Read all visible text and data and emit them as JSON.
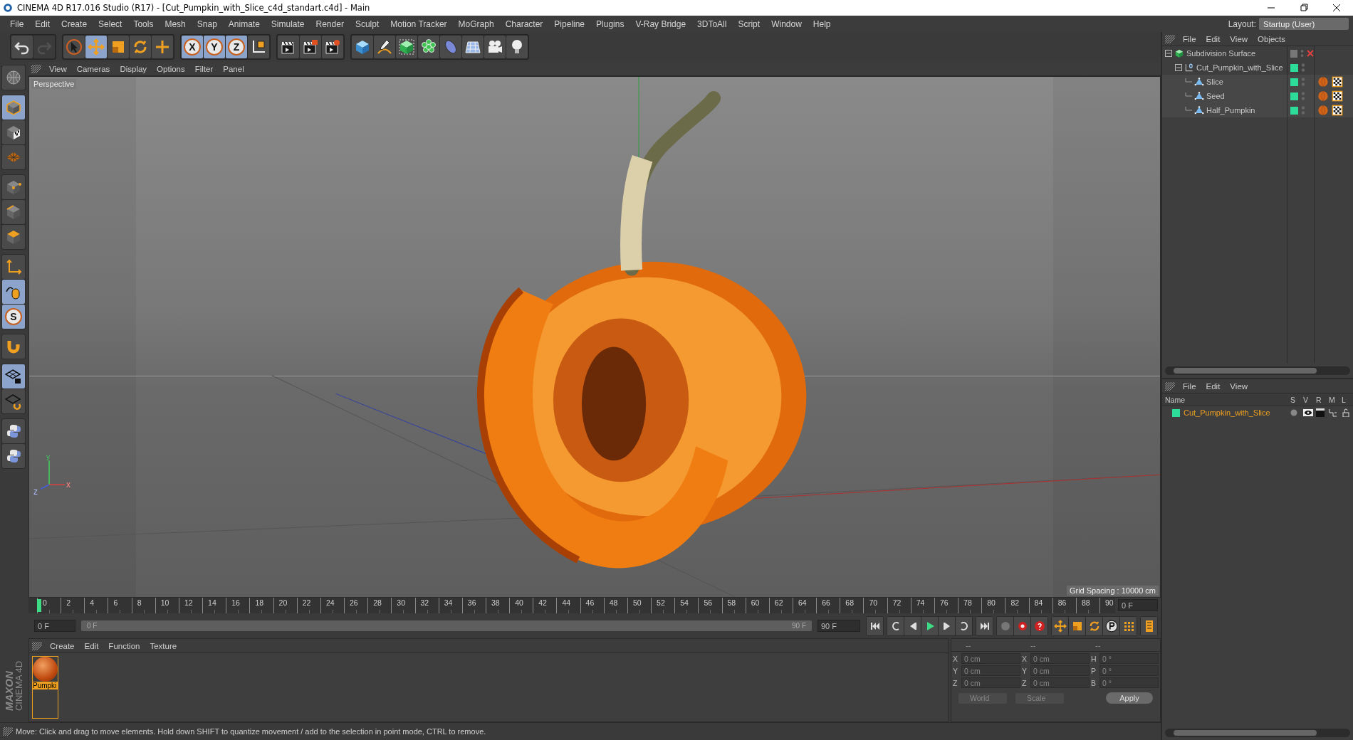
{
  "window": {
    "title": "CINEMA 4D R17.016 Studio (R17) - [Cut_Pumpkin_with_Slice_c4d_standart.c4d] - Main"
  },
  "menu": [
    "File",
    "Edit",
    "Create",
    "Select",
    "Tools",
    "Mesh",
    "Snap",
    "Animate",
    "Simulate",
    "Render",
    "Sculpt",
    "Motion Tracker",
    "MoGraph",
    "Character",
    "Pipeline",
    "Plugins",
    "V-Ray Bridge",
    "3DToAll",
    "Script",
    "Window",
    "Help"
  ],
  "layout": {
    "label": "Layout:",
    "value": "Startup (User)"
  },
  "toolbar": [
    [
      {
        "kind": "undo",
        "selected": false,
        "disabled": false
      },
      {
        "kind": "redo",
        "selected": false,
        "disabled": true
      }
    ],
    [
      {
        "kind": "cursor",
        "selected": false,
        "disabled": false
      },
      {
        "kind": "move",
        "selected": true,
        "disabled": false
      },
      {
        "kind": "scale",
        "selected": false,
        "disabled": false
      },
      {
        "kind": "rotate",
        "selected": false,
        "disabled": false
      },
      {
        "kind": "crosshair",
        "selected": false,
        "disabled": false
      }
    ],
    [
      {
        "kind": "letter",
        "label": "X",
        "selected": true,
        "disabled": false
      },
      {
        "kind": "letter",
        "label": "Y",
        "selected": true,
        "disabled": false
      },
      {
        "kind": "letter",
        "label": "Z",
        "selected": true,
        "disabled": false
      },
      {
        "kind": "axes",
        "selected": false,
        "disabled": false
      }
    ],
    [
      {
        "kind": "render-view",
        "selected": false,
        "disabled": false
      },
      {
        "kind": "render-picture",
        "selected": false,
        "disabled": false
      },
      {
        "kind": "render-settings",
        "selected": false,
        "disabled": false
      }
    ],
    [
      {
        "kind": "cube",
        "selected": false,
        "disabled": false
      },
      {
        "kind": "pen",
        "selected": false,
        "disabled": false
      },
      {
        "kind": "green-cube",
        "selected": false,
        "disabled": false
      },
      {
        "kind": "cluster",
        "selected": false,
        "disabled": false
      },
      {
        "kind": "bend",
        "selected": false,
        "disabled": false
      },
      {
        "kind": "floor",
        "selected": false,
        "disabled": false
      },
      {
        "kind": "camera",
        "selected": false,
        "disabled": false
      },
      {
        "kind": "bulb",
        "selected": false,
        "disabled": false
      }
    ]
  ],
  "left_tools": [
    [
      {
        "kind": "globe",
        "selected": false
      }
    ],
    [
      {
        "kind": "model",
        "selected": true
      },
      {
        "kind": "texture",
        "selected": false
      },
      {
        "kind": "workplane",
        "selected": false
      }
    ],
    [
      {
        "kind": "points",
        "selected": false
      },
      {
        "kind": "edges",
        "selected": false
      },
      {
        "kind": "polygons",
        "selected": false
      }
    ],
    [
      {
        "kind": "axis-l",
        "selected": false
      },
      {
        "kind": "tweak",
        "selected": true
      },
      {
        "kind": "letter",
        "label": "S",
        "selected": true
      }
    ],
    [
      {
        "kind": "magnet",
        "selected": false
      }
    ],
    [
      {
        "kind": "grid-lock",
        "selected": true
      },
      {
        "kind": "grid-rotate",
        "selected": false
      }
    ],
    [
      {
        "kind": "python",
        "selected": false
      },
      {
        "kind": "python",
        "selected": false
      }
    ]
  ],
  "viewport": {
    "menu": [
      "View",
      "Cameras",
      "Display",
      "Options",
      "Filter",
      "Panel"
    ],
    "camera_label": "Perspective",
    "grid_spacing": "Grid Spacing : 10000 cm",
    "gizmo": [
      "y",
      "z",
      "x"
    ]
  },
  "timeline": {
    "ticks": [
      "0",
      "2",
      "4",
      "6",
      "8",
      "10",
      "12",
      "14",
      "16",
      "18",
      "20",
      "22",
      "24",
      "26",
      "28",
      "30",
      "32",
      "34",
      "36",
      "38",
      "40",
      "42",
      "44",
      "46",
      "48",
      "50",
      "52",
      "54",
      "56",
      "58",
      "60",
      "62",
      "64",
      "66",
      "68",
      "70",
      "72",
      "74",
      "76",
      "78",
      "80",
      "82",
      "84",
      "86",
      "88",
      "90"
    ],
    "playhead": {
      "level": 0
    },
    "end_field": "0 F",
    "current_field": "0 F",
    "range": {
      "start": "0 F",
      "end": "90 F",
      "level": 1
    },
    "max_field": "90 F"
  },
  "materials": {
    "menu": [
      "Create",
      "Edit",
      "Function",
      "Texture"
    ],
    "items": [
      {
        "name": "Pumpki",
        "selected": true
      }
    ]
  },
  "coordinates": {
    "headers": [
      "--",
      "--",
      "--"
    ],
    "rows": [
      [
        {
          "label": "X",
          "value": "0 cm"
        },
        {
          "label": "X",
          "value": "0 cm"
        },
        {
          "label": "H",
          "value": "0 °"
        }
      ],
      [
        {
          "label": "Y",
          "value": "0 cm"
        },
        {
          "label": "Y",
          "value": "0 cm"
        },
        {
          "label": "P",
          "value": "0 °"
        }
      ],
      [
        {
          "label": "Z",
          "value": "0 cm"
        },
        {
          "label": "Z",
          "value": "0 cm"
        },
        {
          "label": "B",
          "value": "0 °"
        }
      ]
    ],
    "dropdowns": [
      "World",
      "Scale"
    ],
    "apply": "Apply"
  },
  "objects": {
    "menu": [
      "File",
      "Edit",
      "View",
      "Objects"
    ],
    "tree": [
      {
        "name": "Subdivision Surface",
        "kind": "subdivision",
        "expanded": true,
        "enabled": false,
        "layer": false,
        "children": [
          {
            "name": "Cut_Pumpkin_with_Slice",
            "kind": "null",
            "expanded": true,
            "layer": true,
            "children": [
              {
                "name": "Slice",
                "kind": "polygon",
                "layer": true,
                "tags": [
                  {
                    "kind": "material"
                  },
                  {
                    "kind": "texture"
                  }
                ]
              },
              {
                "name": "Seed",
                "kind": "polygon",
                "layer": true,
                "tags": [
                  {
                    "kind": "material"
                  },
                  {
                    "kind": "texture"
                  }
                ]
              },
              {
                "name": "Half_Pumpkin",
                "kind": "polygon",
                "layer": true,
                "tags": [
                  {
                    "kind": "material"
                  },
                  {
                    "kind": "texture"
                  }
                ]
              }
            ]
          }
        ]
      }
    ]
  },
  "layers": {
    "menu": [
      "File",
      "Edit",
      "View"
    ],
    "columns": [
      "Name",
      "S",
      "V",
      "R",
      "M",
      "L"
    ],
    "rows": [
      {
        "name": "Cut_Pumpkin_with_Slice"
      }
    ]
  },
  "logo": {
    "line1": "MAXON",
    "line2": "CINEMA 4D"
  },
  "status_bar": "Move: Click and drag to move elements. Hold down SHIFT to quantize movement / add to the selection in point mode, CTRL to remove."
}
